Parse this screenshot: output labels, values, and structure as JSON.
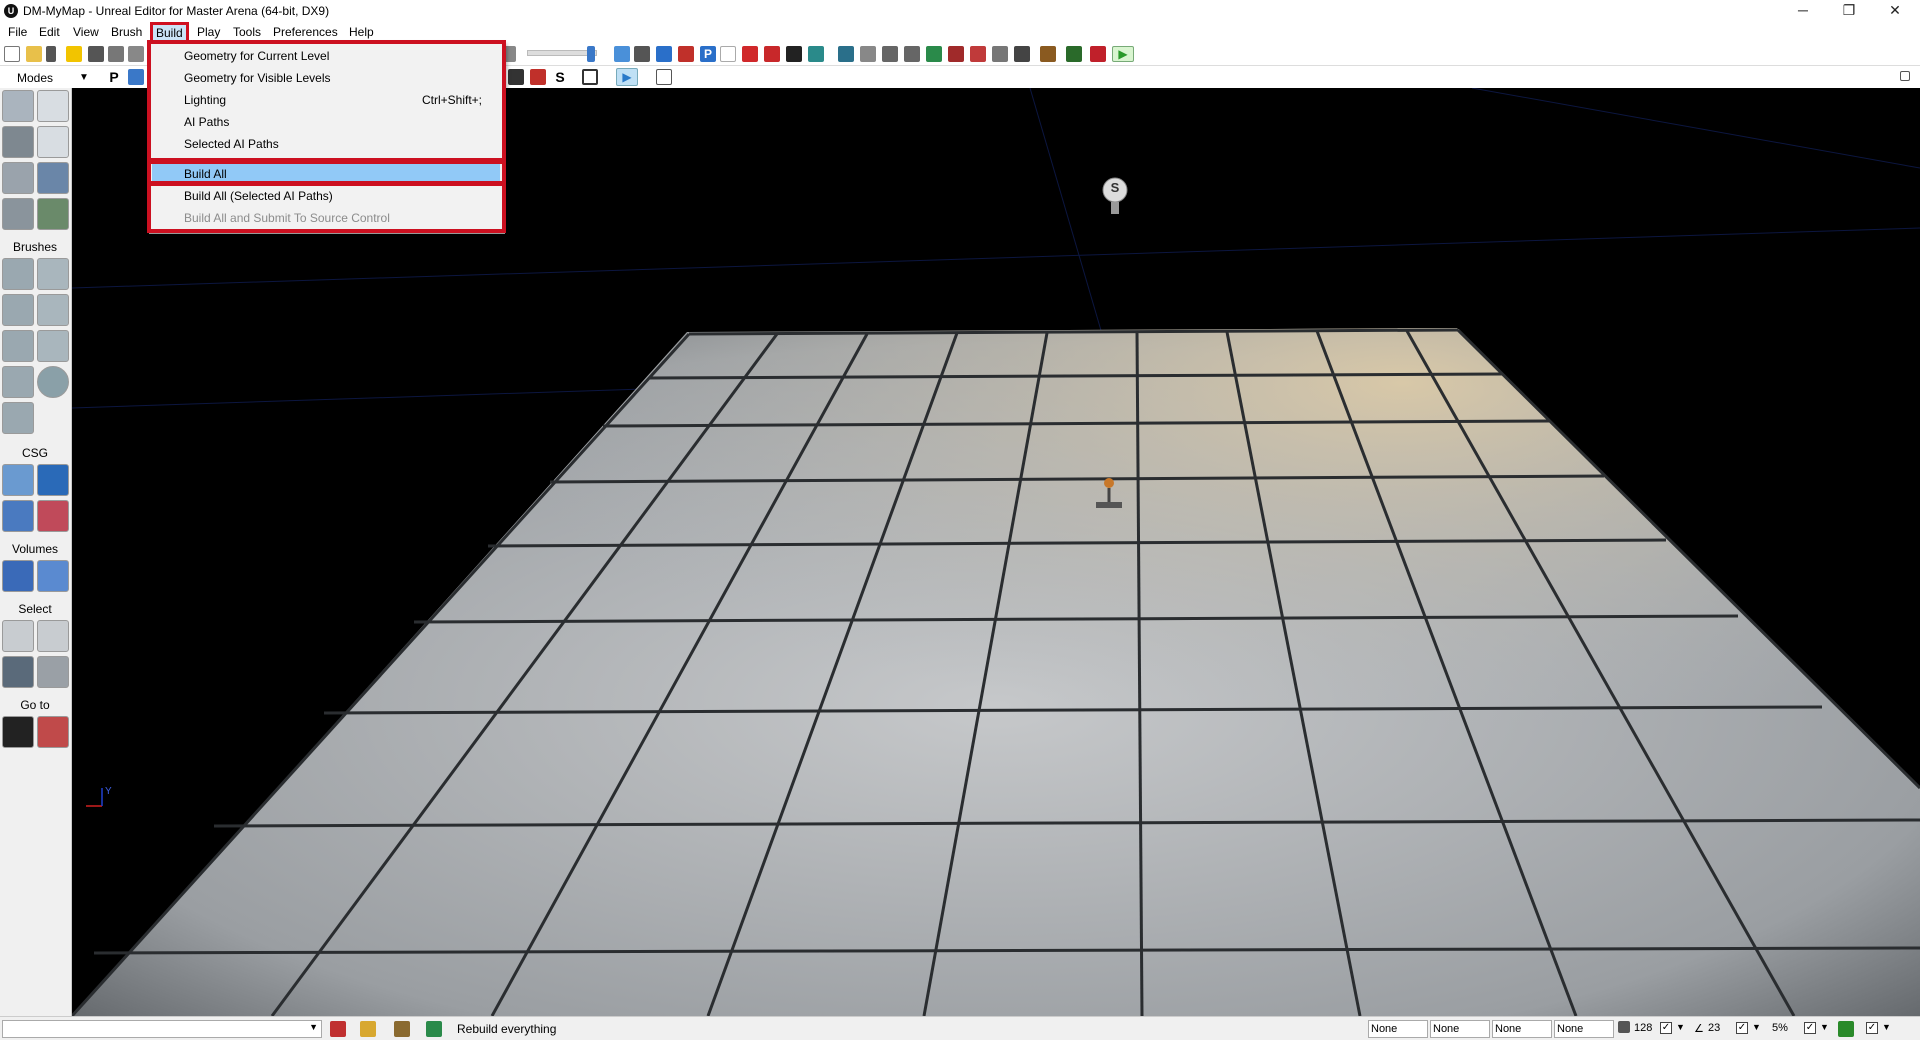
{
  "window": {
    "app_icon": "U",
    "title": "DM-MyMap - Unreal Editor for Master Arena (64-bit, DX9)",
    "minimize": "─",
    "maximize": "❐",
    "close": "✕"
  },
  "menu": {
    "items": [
      "File",
      "Edit",
      "View",
      "Brush",
      "Build",
      "Play",
      "Tools",
      "Preferences",
      "Help"
    ],
    "active": "Build"
  },
  "build_menu": {
    "items": [
      {
        "label": "Geometry for Current Level",
        "shortcut": ""
      },
      {
        "label": "Geometry for Visible Levels",
        "shortcut": ""
      },
      {
        "label": "Lighting",
        "shortcut": "Ctrl+Shift+;"
      },
      {
        "label": "AI Paths",
        "shortcut": ""
      },
      {
        "label": "Selected AI Paths",
        "shortcut": ""
      },
      {
        "label": "Build All",
        "shortcut": ""
      },
      {
        "label": "Build All (Selected AI Paths)",
        "shortcut": ""
      },
      {
        "label": "Build All and Submit To Source Control",
        "shortcut": "",
        "disabled": true
      }
    ],
    "highlighted": "Build All"
  },
  "toolbar2": {
    "p_label": "P"
  },
  "left_panel": {
    "modes_label": "Modes",
    "sections": {
      "brushes": "Brushes",
      "csg": "CSG",
      "volumes": "Volumes",
      "select": "Select",
      "goto": "Go to"
    }
  },
  "viewport": {
    "light_label": "S",
    "axis_y": "Y"
  },
  "status": {
    "message": "Rebuild everything",
    "fields": [
      "None",
      "None",
      "None",
      "None"
    ],
    "grid_size": "128",
    "rotation_snap": "23",
    "scale_snap": "5%"
  },
  "colors": {
    "highlight_border": "#cc1020",
    "menu_highlight": "#91c9f7",
    "viewport_bg": "#000000",
    "floor": "#b9bcbf"
  },
  "icons": [
    "new-icon",
    "open-icon",
    "save-icon",
    "play-icon",
    "camera-icon",
    "cube-icon",
    "terrain-icon",
    "move-icon",
    "brush-icon",
    "tree-icon",
    "sphere-icon",
    "cylinder-icon",
    "cone-icon",
    "volume-icon",
    "light-icon",
    "player-start-icon"
  ]
}
